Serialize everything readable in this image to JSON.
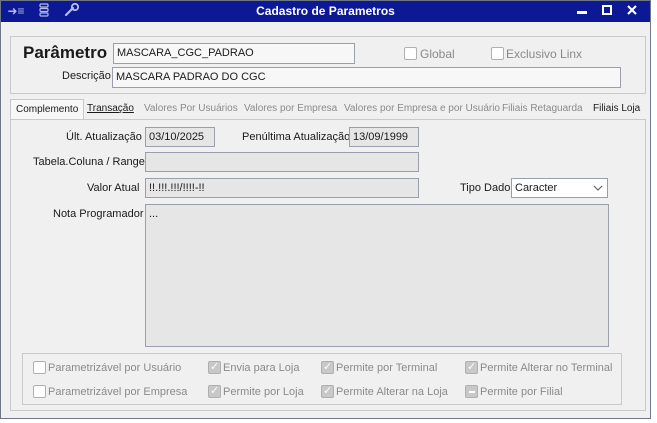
{
  "window": {
    "title": "Cadastro de Parametros",
    "icons": [
      "arrow-list-icon",
      "stack-icon",
      "wrench-icon"
    ],
    "controls": {
      "minimize": "▬",
      "maximize": "□",
      "close": "✕"
    }
  },
  "header": {
    "parametro_label": "Parâmetro",
    "parametro_value": "MASCARA_CGC_PADRAO",
    "descricao_label": "Descrição",
    "descricao_value": "MASCARA PADRAO DO CGC",
    "global_label": "Global",
    "global_checked": false,
    "exclusivo_label": "Exclusivo Linx",
    "exclusivo_checked": false
  },
  "tabs": [
    {
      "label": "Complemento",
      "active": true,
      "enabled": true
    },
    {
      "label": "Transação",
      "active": false,
      "enabled": true
    },
    {
      "label": "Valores Por Usuários",
      "active": false,
      "enabled": false
    },
    {
      "label": "Valores por Empresa",
      "active": false,
      "enabled": false
    },
    {
      "label": "Valores por Empresa e por Usuário",
      "active": false,
      "enabled": false
    },
    {
      "label": "Filiais Retaguarda",
      "active": false,
      "enabled": false
    },
    {
      "label": "Filiais Loja",
      "active": false,
      "enabled": true
    }
  ],
  "complemento": {
    "ult_atualizacao_label": "Últ. Atualização",
    "ult_atualizacao_value": "03/10/2025",
    "penultima_label": "Penúltima Atualização",
    "penultima_value": "13/09/1999",
    "tabela_label": "Tabela.Coluna / Range",
    "tabela_value": "",
    "valor_atual_label": "Valor Atual",
    "valor_atual_value": "!!.!!!.!!!/!!!!-!!",
    "tipo_dado_label": "Tipo Dado",
    "tipo_dado_value": "Caracter",
    "nota_label": "Nota Programador",
    "nota_value": "..."
  },
  "options": {
    "parametrizavel_usuario": {
      "label": "Parametrizável por Usuário",
      "state": "unchecked"
    },
    "envia_loja": {
      "label": "Envia para Loja",
      "state": "checked"
    },
    "permite_terminal": {
      "label": "Permite por Terminal",
      "state": "checked"
    },
    "permite_alterar_terminal": {
      "label": "Permite Alterar no Terminal",
      "state": "checked"
    },
    "parametrizavel_empresa": {
      "label": "Parametrizável por Empresa",
      "state": "unchecked"
    },
    "permite_loja": {
      "label": "Permite por Loja",
      "state": "checked"
    },
    "permite_alterar_loja": {
      "label": "Permite Alterar na Loja",
      "state": "checked"
    },
    "permite_filial": {
      "label": "Permite por Filial",
      "state": "indeterminate"
    }
  }
}
